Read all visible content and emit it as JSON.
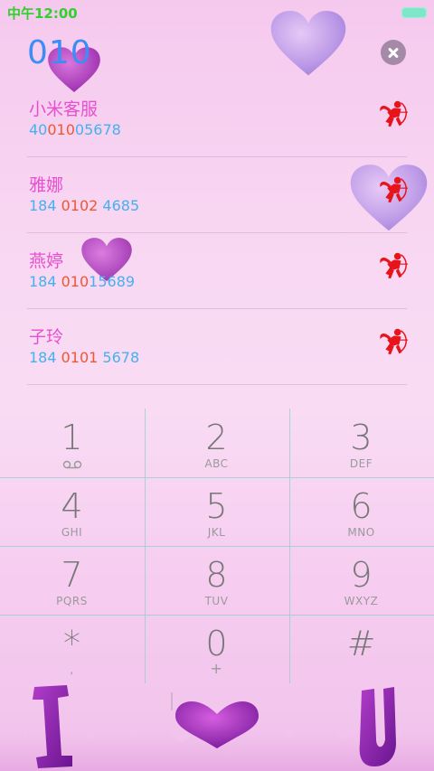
{
  "status_bar": {
    "time": "中午12:00"
  },
  "dialer": {
    "input_digits": "010"
  },
  "contacts": [
    {
      "name": "小米客服",
      "number_pre": "40",
      "number_hl": "010",
      "number_post": "05678"
    },
    {
      "name": "雅娜",
      "number_pre": "184 ",
      "number_hl": "0102",
      "number_post": " 4685"
    },
    {
      "name": "燕婷",
      "number_pre": "184 ",
      "number_hl": "010",
      "number_post": "15689"
    },
    {
      "name": "子玲",
      "number_pre": "184 ",
      "number_hl": "0101",
      "number_post": " 5678"
    }
  ],
  "keypad": [
    {
      "digit": "1",
      "letters": ""
    },
    {
      "digit": "2",
      "letters": "ABC"
    },
    {
      "digit": "3",
      "letters": "DEF"
    },
    {
      "digit": "4",
      "letters": "GHI"
    },
    {
      "digit": "5",
      "letters": "JKL"
    },
    {
      "digit": "6",
      "letters": "MNO"
    },
    {
      "digit": "7",
      "letters": "PQRS"
    },
    {
      "digit": "8",
      "letters": "TUV"
    },
    {
      "digit": "9",
      "letters": "WXYZ"
    },
    {
      "digit": "*",
      "letters": ","
    },
    {
      "digit": "0",
      "letters": "+"
    },
    {
      "digit": "#",
      "letters": ""
    }
  ],
  "icons": {
    "contact_action": "cupid-icon",
    "clear": "close-icon",
    "voicemail": "voicemail-icon"
  },
  "colors": {
    "accent_digits": "#3d8df5",
    "name": "#e84fcf",
    "number": "#45b1f0",
    "number_highlight": "#f0562f",
    "status_time": "#2fd12a",
    "cupid": "#e8141b"
  }
}
